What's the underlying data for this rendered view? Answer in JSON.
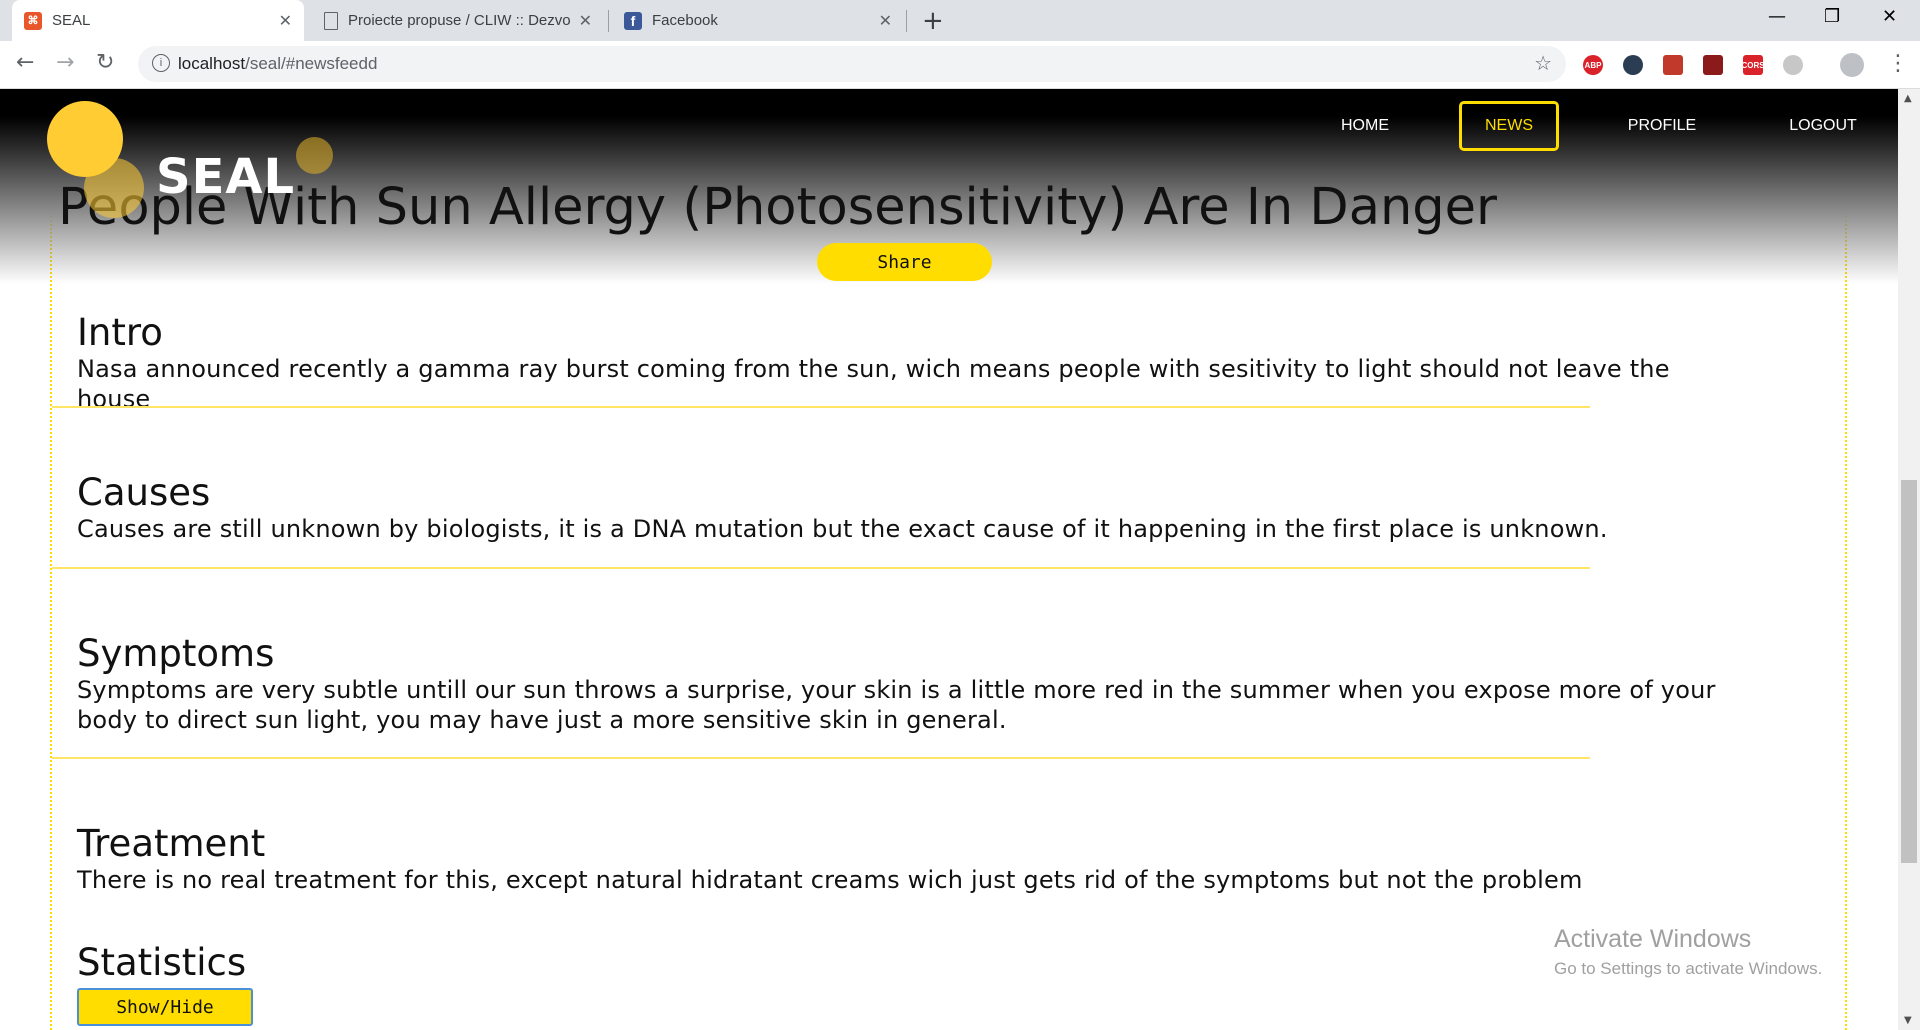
{
  "browser": {
    "tabs": [
      {
        "title": "SEAL",
        "favicon": "seal-favicon-icon",
        "close": "✕"
      },
      {
        "title": "Proiecte propuse / CLIW :: Dezvo",
        "favicon": "page-icon",
        "close": "✕"
      },
      {
        "title": "Facebook",
        "favicon": "facebook-icon",
        "close": "✕"
      }
    ],
    "new_tab": "+",
    "window_controls": {
      "minimize": "—",
      "maximize": "❐",
      "close": "✕"
    },
    "url_host": "localhost",
    "url_path": "/seal/#newsfeedd",
    "extensions": [
      {
        "name": "adblock-plus-icon",
        "label": "ABP",
        "color": "#d9222a"
      },
      {
        "name": "ghostery-icon",
        "label": "",
        "color": "#2a3d52"
      },
      {
        "name": "extension-icon",
        "label": "",
        "color": "#c0392b"
      },
      {
        "name": "extension-icon",
        "label": "",
        "color": "#8b1a1a"
      },
      {
        "name": "cors-icon",
        "label": "CORS",
        "color": "#d9222a"
      },
      {
        "name": "extension-icon",
        "label": "",
        "color": "#c7c7c7"
      }
    ]
  },
  "site": {
    "logo": "SEAL",
    "nav": [
      "HOME",
      "NEWS",
      "PROFILE",
      "LOGOUT"
    ],
    "active_nav": "NEWS",
    "accent_color": "#ffdd00"
  },
  "article": {
    "title": "People With Sun Allergy (Photosensitivity) Are In Danger",
    "share_label": "Share",
    "sections": [
      {
        "heading": "Intro",
        "body": "Nasa announced recently a gamma ray burst coming from the sun, wich means people with sesitivity to light should not leave the house"
      },
      {
        "heading": "Causes",
        "body": "Causes are still unknown by biologists, it is a DNA mutation but the exact cause of it happening in the first place is unknown."
      },
      {
        "heading": "Symptoms",
        "body": "Symptoms are very subtle untill our sun throws a surprise, your skin is a little more red in the summer when you expose more of your body to direct sun light, you may have just a more sensitive skin in general."
      },
      {
        "heading": "Treatment",
        "body": "There is no real treatment for this, except natural hidratant creams wich just gets rid of the symptoms but not the problem"
      }
    ],
    "statistics_heading": "Statistics",
    "toggle_label": "Show/Hide"
  },
  "watermark": {
    "line1": "Activate Windows",
    "line2": "Go to Settings to activate Windows."
  }
}
